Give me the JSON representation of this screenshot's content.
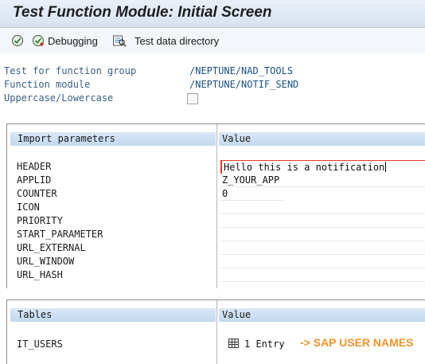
{
  "window": {
    "title": "Test Function Module: Initial Screen"
  },
  "toolbar": {
    "items": [
      {
        "label": "",
        "icon": "execute-icon"
      },
      {
        "label": "Debugging",
        "icon": "debug-execute-icon"
      },
      {
        "label": "Test data directory",
        "icon": "test-data-directory-icon"
      }
    ]
  },
  "form": {
    "function_group_label": "Test for function group",
    "function_group_value": "/NEPTUNE/NAD_TOOLS",
    "function_module_label": "Function module",
    "function_module_value": "/NEPTUNE/NOTIF_SEND",
    "case_label": "Uppercase/Lowercase",
    "case_checked": false
  },
  "import_params": {
    "header_name": "Import parameters",
    "header_value": "Value",
    "rows": [
      {
        "name": "HEADER",
        "value": "Hello this is a notification"
      },
      {
        "name": "APPLID",
        "value": "Z_YOUR_APP"
      },
      {
        "name": "COUNTER",
        "value": "0"
      },
      {
        "name": "ICON",
        "value": ""
      },
      {
        "name": "PRIORITY",
        "value": ""
      },
      {
        "name": "START_PARAMETER",
        "value": ""
      },
      {
        "name": "URL_EXTERNAL",
        "value": ""
      },
      {
        "name": "URL_WINDOW",
        "value": ""
      },
      {
        "name": "URL_HASH",
        "value": ""
      }
    ]
  },
  "tables": {
    "header_name": "Tables",
    "header_value": "Value",
    "rows": [
      {
        "name": "IT_USERS",
        "value": "1 Entry"
      }
    ]
  },
  "annotation": {
    "text": "-> SAP USER NAMES",
    "color": "#f0932b"
  }
}
